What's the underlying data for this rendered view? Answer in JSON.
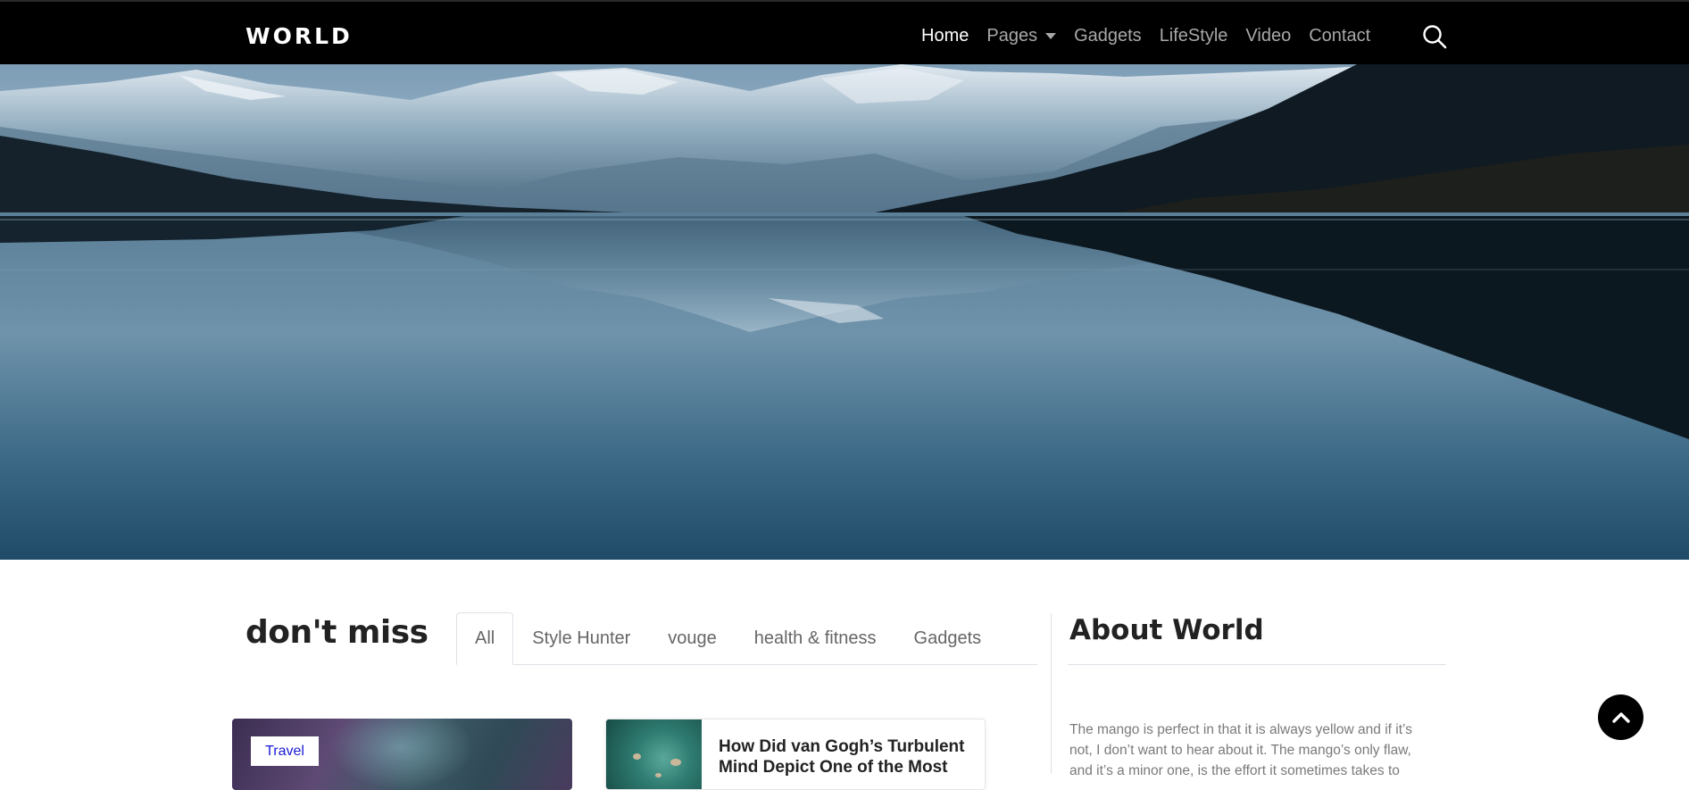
{
  "brand": {
    "logo": "WORLD"
  },
  "nav": {
    "items": [
      {
        "label": "Home",
        "active": true
      },
      {
        "label": "Pages",
        "dropdown": true
      },
      {
        "label": "Gadgets"
      },
      {
        "label": "LifeStyle"
      },
      {
        "label": "Video"
      },
      {
        "label": "Contact"
      }
    ],
    "search_icon": "search-icon"
  },
  "hero": {
    "image": "mountain-lake-reflection"
  },
  "section": {
    "title": "don't miss",
    "tabs": [
      {
        "label": "All",
        "active": true
      },
      {
        "label": "Style Hunter"
      },
      {
        "label": "vouge"
      },
      {
        "label": "health & fitness"
      },
      {
        "label": "Gadgets"
      }
    ]
  },
  "cards": [
    {
      "category": "Travel"
    },
    {
      "title": "How Did van Gogh’s Turbulent Mind Depict One of the Most"
    }
  ],
  "sidebar": {
    "title": "About World",
    "text": "The mango is perfect in that it is always yellow and if it’s not, I don’t want to hear about it. The mango’s only flaw, and it’s a minor one, is the effort it sometimes takes to"
  },
  "colors": {
    "navbar": "#000000",
    "nav_active": "#ffffff",
    "nav_inactive": "#a8a8a8",
    "badge_text": "#1a1adb"
  }
}
